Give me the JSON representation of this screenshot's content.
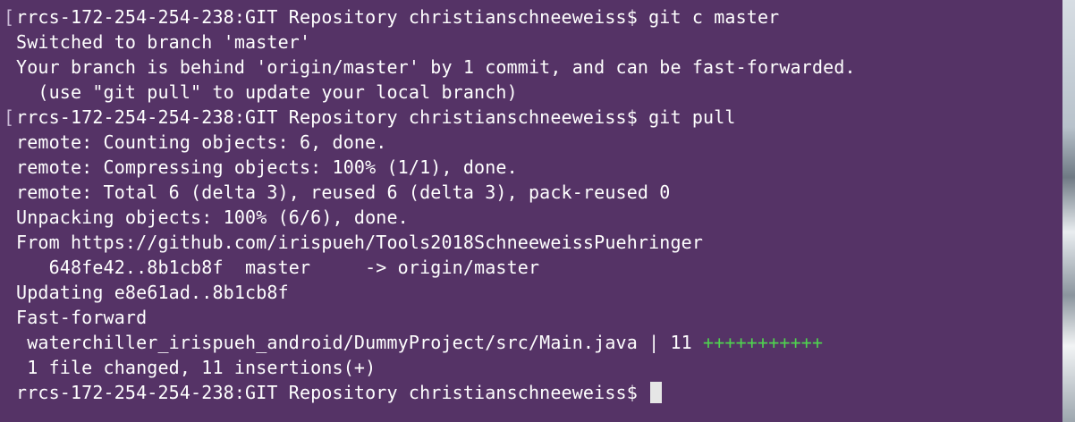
{
  "terminal": {
    "lines": [
      {
        "text": "rrcs-172-254-254-238:GIT Repository christianschneeweiss$ git c master",
        "mark": true
      },
      {
        "text": "Switched to branch 'master'"
      },
      {
        "text": "Your branch is behind 'origin/master' by 1 commit, and can be fast-forwarded."
      },
      {
        "text": "  (use \"git pull\" to update your local branch)"
      },
      {
        "text": "rrcs-172-254-254-238:GIT Repository christianschneeweiss$ git pull",
        "mark": true
      },
      {
        "text": "remote: Counting objects: 6, done."
      },
      {
        "text": "remote: Compressing objects: 100% (1/1), done."
      },
      {
        "text": "remote: Total 6 (delta 3), reused 6 (delta 3), pack-reused 0"
      },
      {
        "text": "Unpacking objects: 100% (6/6), done."
      },
      {
        "text": "From https://github.com/irispueh/Tools2018SchneeweissPuehringer"
      },
      {
        "text": "   648fe42..8b1cb8f  master     -> origin/master"
      },
      {
        "text": "Updating e8e61ad..8b1cb8f"
      },
      {
        "text": "Fast-forward"
      },
      {
        "text": " waterchiller_irispueh_android/DummyProject/src/Main.java | 11 ",
        "plus": "+++++++++++"
      },
      {
        "text": " 1 file changed, 11 insertions(+)"
      },
      {
        "text": "rrcs-172-254-254-238:GIT Repository christianschneeweiss$ ",
        "cursor": true
      }
    ],
    "bracket_char": "[",
    "colors": {
      "background": "#553366",
      "foreground": "#ffffff",
      "insertions": "#4fd24f",
      "cursor": "#e6e6e6"
    }
  }
}
